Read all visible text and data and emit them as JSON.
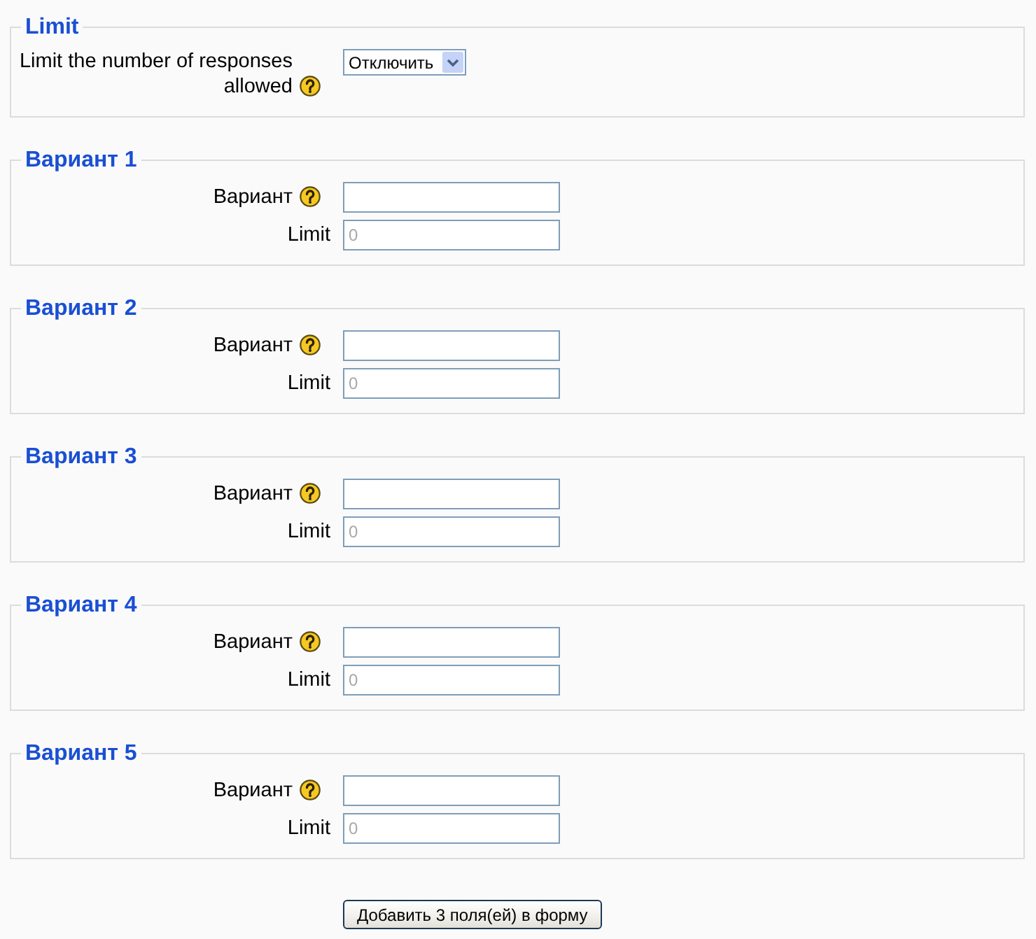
{
  "sections": [
    {
      "legend": "Limit",
      "fields": [
        {
          "kind": "select",
          "label": "Limit the number of responses allowed",
          "help": true,
          "value": "Отключить"
        }
      ]
    },
    {
      "legend": "Вариант 1",
      "fields": [
        {
          "kind": "text",
          "label": "Вариант",
          "help": true,
          "disabled": false
        },
        {
          "kind": "text",
          "label": "Limit",
          "help": false,
          "value": "0",
          "disabled": true
        }
      ]
    },
    {
      "legend": "Вариант 2",
      "fields": [
        {
          "kind": "text",
          "label": "Вариант",
          "help": true,
          "disabled": false
        },
        {
          "kind": "text",
          "label": "Limit",
          "help": false,
          "value": "0",
          "disabled": true
        }
      ]
    },
    {
      "legend": "Вариант 3",
      "fields": [
        {
          "kind": "text",
          "label": "Вариант",
          "help": true,
          "disabled": false
        },
        {
          "kind": "text",
          "label": "Limit",
          "help": false,
          "value": "0",
          "disabled": true
        }
      ]
    },
    {
      "legend": "Вариант 4",
      "fields": [
        {
          "kind": "text",
          "label": "Вариант",
          "help": true,
          "disabled": false
        },
        {
          "kind": "text",
          "label": "Limit",
          "help": false,
          "value": "0",
          "disabled": true
        }
      ]
    },
    {
      "legend": "Вариант 5",
      "fields": [
        {
          "kind": "text",
          "label": "Вариант",
          "help": true,
          "disabled": false
        },
        {
          "kind": "text",
          "label": "Limit",
          "help": false,
          "value": "0",
          "disabled": true
        }
      ]
    }
  ],
  "add_button": {
    "label": "Добавить 3 поля(ей) в форму"
  }
}
